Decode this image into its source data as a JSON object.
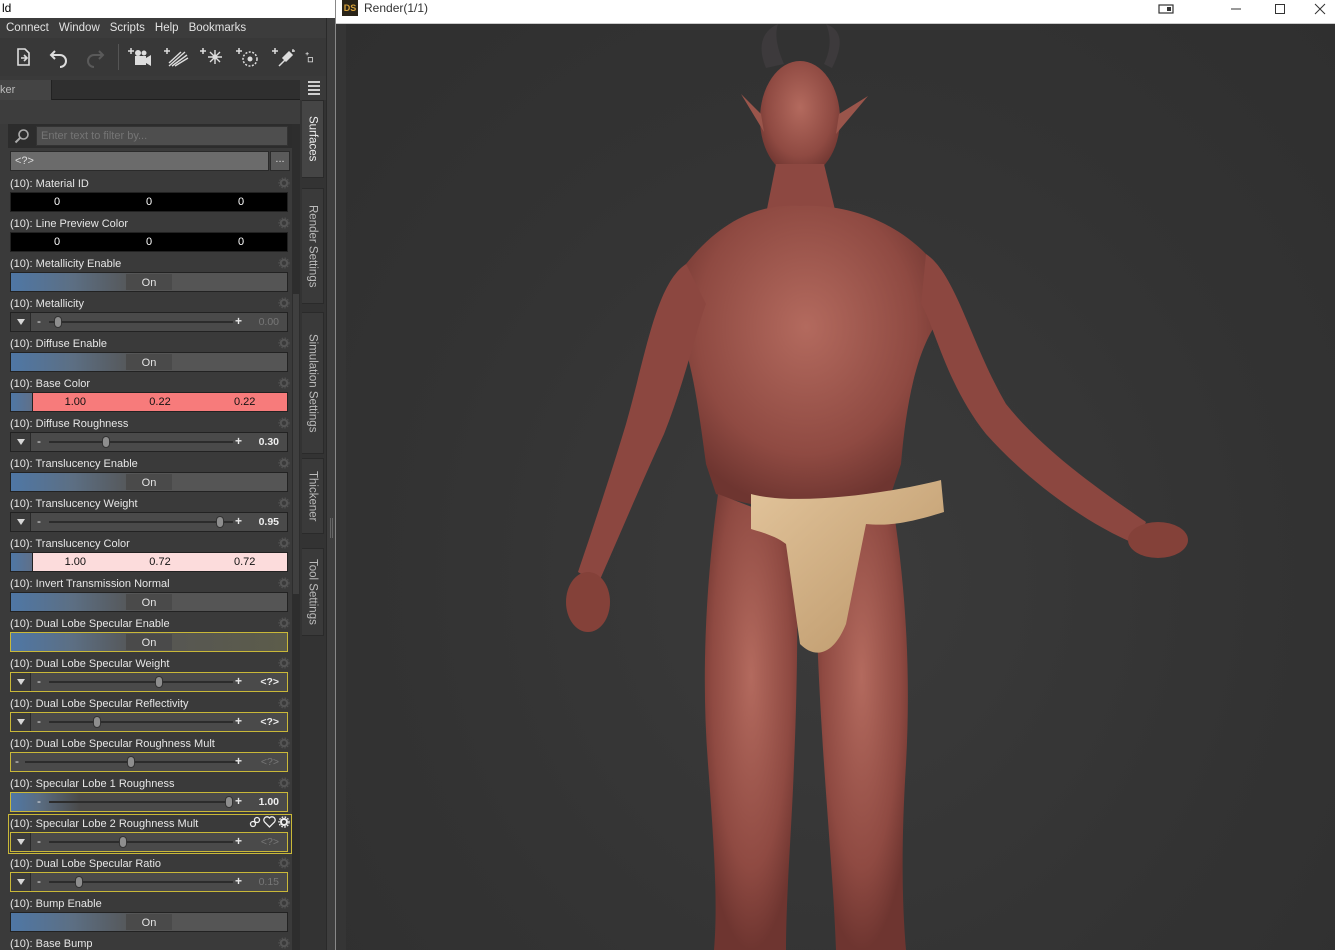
{
  "main_window": {
    "title_fragment": "ld",
    "menu": [
      {
        "label": "Connect"
      },
      {
        "label": "Window"
      },
      {
        "label": "Scripts"
      },
      {
        "label": "Help"
      },
      {
        "label": "Bookmarks"
      }
    ],
    "toolbar_icons": [
      "export-icon",
      "undo-icon",
      "redo-icon",
      "add-camera-icon",
      "add-distant-light-icon",
      "add-spot-light-icon",
      "add-point-light-icon",
      "add-light-icon",
      "add-object-icon"
    ]
  },
  "panel": {
    "tab_label": "ker",
    "filter_placeholder": "Enter text to filter by...",
    "selector_value": "<?>",
    "selector_more": "...",
    "properties": [
      {
        "label": "(10): Material ID",
        "type": "num",
        "values": [
          "0",
          "0",
          "0"
        ]
      },
      {
        "label": "(10): Line Preview Color",
        "type": "num",
        "values": [
          "0",
          "0",
          "0"
        ]
      },
      {
        "label": "(10): Metallicity Enable",
        "type": "toggle",
        "value": "On"
      },
      {
        "label": "(10): Metallicity",
        "type": "slider",
        "value": "0.00",
        "pos": 0.03,
        "bright": false
      },
      {
        "label": "(10): Diffuse Enable",
        "type": "toggle",
        "value": "On"
      },
      {
        "label": "(10): Base Color",
        "type": "color",
        "values": [
          "1.00",
          "0.22",
          "0.22"
        ],
        "color": "#f77b7b"
      },
      {
        "label": "(10): Diffuse Roughness",
        "type": "slider",
        "value": "0.30",
        "pos": 0.3,
        "bright": true
      },
      {
        "label": "(10): Translucency Enable",
        "type": "toggle",
        "value": "On"
      },
      {
        "label": "(10): Translucency Weight",
        "type": "slider",
        "value": "0.95",
        "pos": 0.95,
        "bright": true
      },
      {
        "label": "(10): Translucency Color",
        "type": "color",
        "values": [
          "1.00",
          "0.72",
          "0.72"
        ],
        "color": "#fcdcdc"
      },
      {
        "label": "(10): Invert Transmission Normal",
        "type": "toggle",
        "value": "On"
      },
      {
        "label": "(10): Dual Lobe Specular Enable",
        "type": "toggle",
        "value": "On",
        "hl": true
      },
      {
        "label": "(10): Dual Lobe Specular Weight",
        "type": "slider",
        "value": "<?>",
        "pos": 0.6,
        "bright": true,
        "hl": true
      },
      {
        "label": "(10): Dual Lobe Specular Reflectivity",
        "type": "slider",
        "value": "<?>",
        "pos": 0.25,
        "bright": true,
        "hl": true
      },
      {
        "label": "(10): Dual Lobe Specular Roughness Mult",
        "type": "slider",
        "value": "<?>",
        "pos": 0.5,
        "bright": false,
        "hl": true,
        "wide": true,
        "noTri": true
      },
      {
        "label": "(10): Specular Lobe 1 Roughness",
        "type": "slider",
        "value": "1.00",
        "pos": 1.0,
        "bright": true,
        "hl": true,
        "blue": true
      },
      {
        "label": "(10): Specular Lobe 2 Roughness Mult",
        "type": "slider",
        "value": "<?>",
        "pos": 0.4,
        "bright": false,
        "hl": true,
        "selected": true
      },
      {
        "label": "(10): Dual Lobe Specular Ratio",
        "type": "slider",
        "value": "0.15",
        "pos": 0.15,
        "bright": false,
        "hl": true
      },
      {
        "label": "(10): Bump Enable",
        "type": "toggle",
        "value": "On"
      },
      {
        "label": "(10): Base Bump",
        "type": "slider",
        "value": "",
        "pos": 0.0,
        "bright": false
      }
    ]
  },
  "side_tabs": [
    {
      "label": "Surfaces",
      "active": true
    },
    {
      "label": "Render Settings"
    },
    {
      "label": "Simulation Settings"
    },
    {
      "label": "Thickener"
    },
    {
      "label": "Tool Settings"
    }
  ],
  "render_window": {
    "logo": "DS",
    "title": "Render(1/1)"
  }
}
